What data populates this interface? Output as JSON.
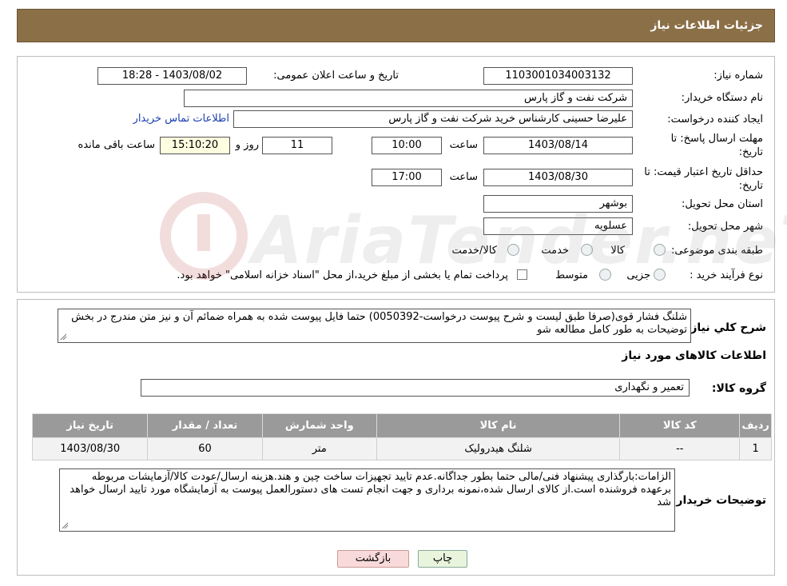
{
  "header": {
    "title": "جزئیات اطلاعات نیاز"
  },
  "form": {
    "need_number_label": "شماره نیاز:",
    "need_number": "1103001034003132",
    "announce_label": "تاریخ و ساعت اعلان عمومی:",
    "announce_value": "1403/08/02 - 18:28",
    "buyer_label": "نام دستگاه خریدار:",
    "buyer_value": "شرکت نفت و گاز پارس",
    "creator_label": "ایجاد کننده درخواست:",
    "creator_value": "علیرضا حسینی کارشناس خرید شرکت نفت و گاز پارس",
    "contact_link": "اطلاعات تماس خریدار",
    "deadline_label": "مهلت ارسال پاسخ: تا تاریخ:",
    "deadline_date": "1403/08/14",
    "time_label": "ساعت",
    "deadline_time": "10:00",
    "days_value": "11",
    "days_label": "روز و",
    "remaining_time": "15:10:20",
    "remaining_label": "ساعت باقی مانده",
    "validity_label": "حداقل تاریخ اعتبار قیمت: تا تاریخ:",
    "validity_date": "1403/08/30",
    "validity_time_label": "ساعت",
    "validity_time": "17:00",
    "province_label": "استان محل تحویل:",
    "province_value": "بوشهر",
    "city_label": "شهر محل تحویل:",
    "city_value": "عسلویه",
    "category_label": "طبقه بندی موضوعی:",
    "category_options": [
      "کالا",
      "خدمت",
      "کالا/خدمت"
    ],
    "process_label": "نوع فرآیند خرید :",
    "process_options": [
      "جزیی",
      "متوسط"
    ],
    "payment_note": "پرداخت تمام یا بخشی از مبلغ خرید،از محل \"اسناد خزانه اسلامی\" خواهد بود."
  },
  "watermark": {
    "text": "AriaTender.neT"
  },
  "details": {
    "summary_label": "شرح کلي نياز:",
    "summary_text": "شلنگ فشار قوی(صرفا طبق لیست و شرح پیوست درخواست-0050392) حتما فایل پیوست شده به همراه ضمائم آن و نیز متن مندرج در بخش توضیحات به طور کامل مطالعه شو",
    "goods_info_title": "اطلاعات کالاهای مورد نیاز",
    "group_label": "گروه کالا:",
    "group_value": "تعمیر و نگهداری",
    "table_headers": [
      "ردیف",
      "کد کالا",
      "نام کالا",
      "واحد شمارش",
      "تعداد / مقدار",
      "تاریخ نیاز"
    ],
    "rows": [
      [
        "1",
        "--",
        "شلنگ هیدرولیک",
        "متر",
        "60",
        "1403/08/30"
      ]
    ],
    "buyer_notes_label": "توضیحات خریدار:",
    "buyer_notes_text": "الزامات:بارگذاری پیشنهاد فنی/مالی حتما بطور جداگانه.عدم تایید تجهیزات ساخت چین و هند.هزینه ارسال/عودت کالا/آزمایشات مربوطه برعهده فروشنده است.از کالای ارسال شده،نمونه برداری و جهت انجام تست های دستورالعمل پیوست به آزمایشگاه مورد تایید ارسال خواهد شد"
  },
  "buttons": {
    "print": "چاپ",
    "back": "بازگشت"
  },
  "colors": {
    "header_bg": "#8b6f47",
    "table_header_bg": "#9a9a9a",
    "link": "#1a3fb0"
  }
}
